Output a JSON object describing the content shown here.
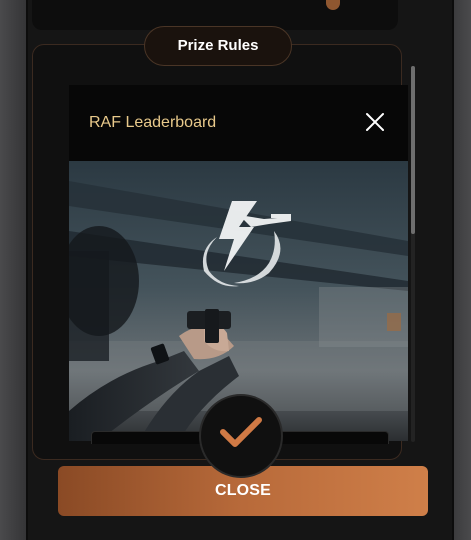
{
  "header": {
    "title": "Prize Rules"
  },
  "modal": {
    "title": "RAF Leaderboard",
    "close_icon": "close-icon"
  },
  "actions": {
    "confirm_icon": "checkmark-icon",
    "close_label": "CLOSE"
  },
  "colors": {
    "accent": "#c57541",
    "title_gold": "#e8c98b",
    "panel_border": "#3b2a20"
  }
}
